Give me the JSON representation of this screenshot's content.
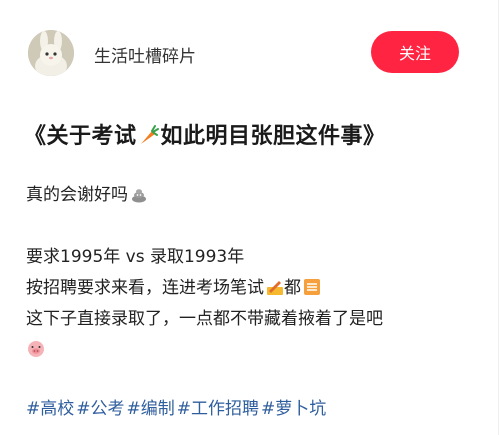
{
  "author": {
    "name": "生活吐槽碎片"
  },
  "follow_button": {
    "label": "关注",
    "color": "#ff2442"
  },
  "post": {
    "title_part1": "《关于考试",
    "title_part2": "如此明目张胆这件事》",
    "title_emoji": "carrot-icon",
    "lines": {
      "l1": "真的会谢好吗",
      "l2": "要求1995年 vs 录取1993年",
      "l3": "按招聘要求来看，连进考场笔试",
      "l3b": "都",
      "l4": "这下子直接录取了，一点都不带藏着掖着了是吧"
    },
    "tags": [
      "#高校",
      "#公考",
      "#编制",
      "#工作招聘",
      "#萝卜坑"
    ]
  },
  "colors": {
    "tag": "#2f5e9e",
    "text": "#222222"
  }
}
